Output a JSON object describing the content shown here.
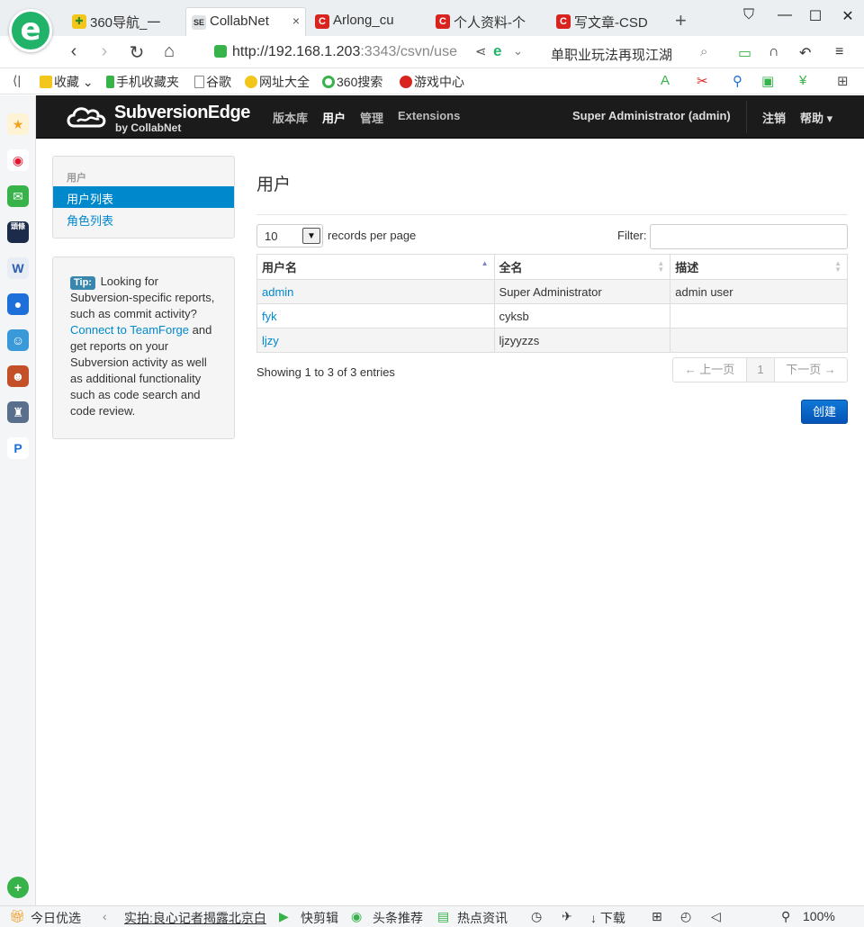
{
  "browser": {
    "tabs": [
      {
        "label": "360导航_一",
        "favicon": "360-icon"
      },
      {
        "label": "CollabNet",
        "favicon": "SE",
        "active": true
      },
      {
        "label": "Arlong_cu",
        "favicon": "C"
      },
      {
        "label": "个人资料-个",
        "favicon": "C"
      },
      {
        "label": "写文章-CSD",
        "favicon": "C"
      }
    ],
    "tab_close": "×",
    "new_tab": "+",
    "url_host": "http://192.168.1.203",
    "url_rest": ":3343/csvn/use",
    "search_hint": "单职业玩法再现江湖",
    "bookmarks": [
      "收藏",
      "手机收藏夹",
      "谷歌",
      "网址大全",
      "360搜索",
      "游戏中心"
    ]
  },
  "statusbar": {
    "items": [
      "今日优选",
      "实拍:良心记者揭露北京白",
      "快剪辑",
      "头条推荐",
      "热点资讯",
      "下载",
      "100%"
    ]
  },
  "app": {
    "brand_name": "SubversionEdge",
    "brand_sub": "by CollabNet",
    "nav": [
      "版本库",
      "用户",
      "管理",
      "Extensions"
    ],
    "active_nav": "用户",
    "user_display": "Super Administrator (admin)",
    "logout": "注销",
    "help": "帮助 ▾"
  },
  "sidebar": {
    "header": "用户",
    "items": [
      {
        "label": "用户列表",
        "active": true
      },
      {
        "label": "角色列表",
        "active": false
      }
    ]
  },
  "tip": {
    "label": "Tip:",
    "text_before": " Looking for Subversion-specific reports, such as commit activity? ",
    "link": "Connect to TeamForge",
    "text_after": " and get reports on your Subversion activity as well as additional functionality such as code search and code review."
  },
  "main": {
    "title": "用户",
    "records_per_page": "10",
    "records_label": "records per page",
    "filter_label": "Filter:",
    "filter_value": "",
    "columns": [
      "用户名",
      "全名",
      "描述"
    ],
    "rows": [
      {
        "username": "admin",
        "fullname": "Super Administrator",
        "description": "admin user"
      },
      {
        "username": "fyk",
        "fullname": "cyksb",
        "description": ""
      },
      {
        "username": "ljzy",
        "fullname": "ljzyyzzs",
        "description": ""
      }
    ],
    "info": "Showing 1 to 3 of 3 entries",
    "pager": {
      "prev": "← 上一页",
      "current": "1",
      "next": "下一页 →"
    },
    "create": "创建"
  }
}
